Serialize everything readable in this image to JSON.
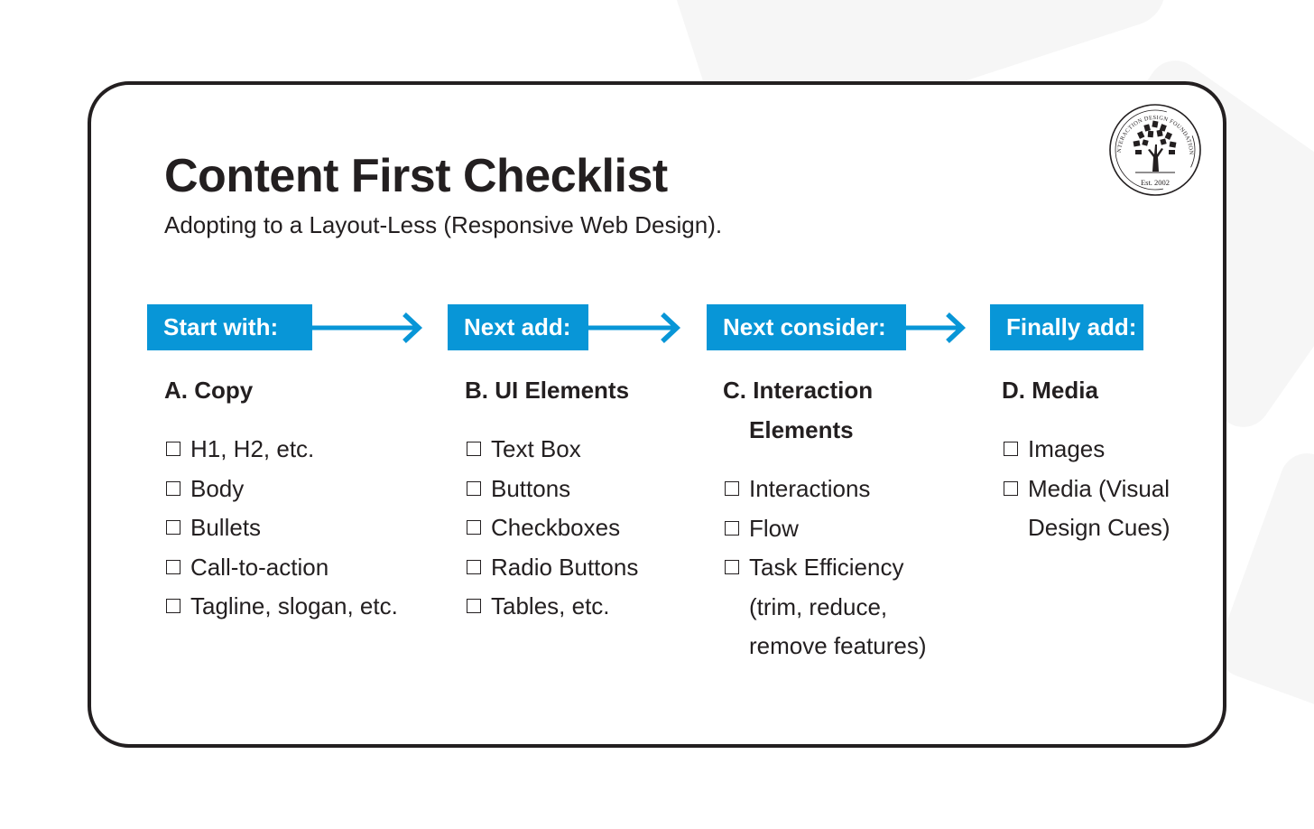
{
  "title": "Content First Checklist",
  "subtitle": "Adopting to a Layout-Less (Responsive Web Design).",
  "logo": {
    "icon": "tree-of-books-icon",
    "ring_text": "INTERACTION DESIGN FOUNDATION",
    "est_text": "Est. 2002"
  },
  "colors": {
    "accent": "#0896d7",
    "text": "#231f20",
    "border": "#231f20"
  },
  "stages": [
    {
      "label": "Start with:",
      "heading": "A. Copy",
      "heading_cont": "",
      "items": [
        "H1, H2, etc.",
        "Body",
        "Bullets",
        "Call-to-action",
        "Tagline, slogan, etc."
      ]
    },
    {
      "label": "Next add:",
      "heading": "B. UI Elements",
      "heading_cont": "",
      "items": [
        "Text Box",
        "Buttons",
        "Checkboxes",
        "Radio Buttons",
        "Tables, etc."
      ]
    },
    {
      "label": "Next consider:",
      "heading": "C. Interaction",
      "heading_cont": "Elements",
      "items": [
        "Interactions",
        "Flow",
        "Task Efficiency (trim, reduce, remove features)"
      ]
    },
    {
      "label": "Finally add:",
      "heading": "D. Media",
      "heading_cont": "",
      "items": [
        "Images",
        "Media (Visual Design Cues)"
      ]
    }
  ]
}
